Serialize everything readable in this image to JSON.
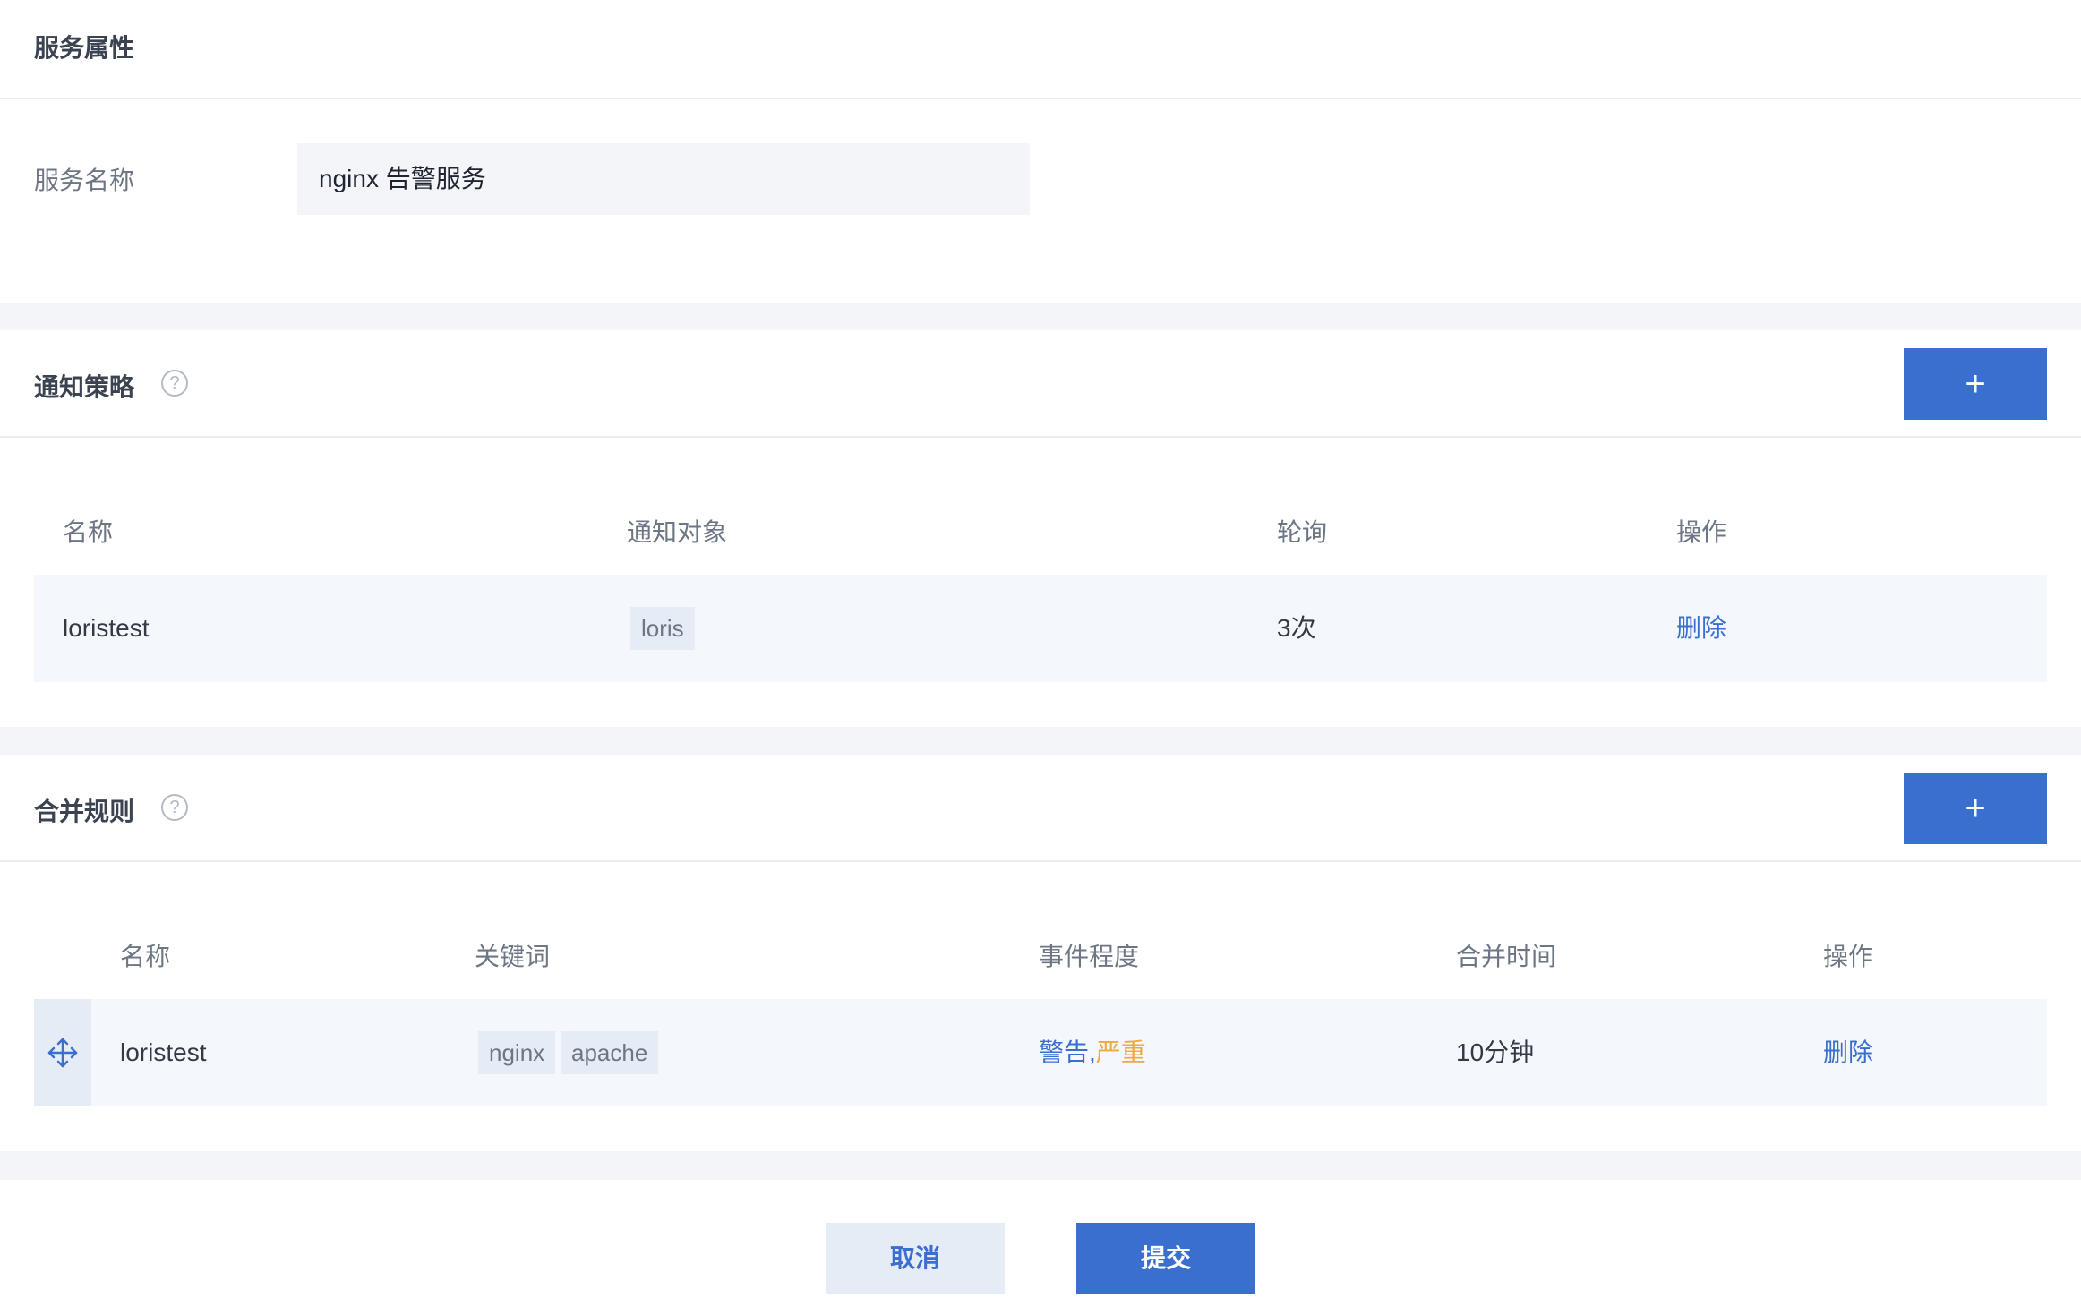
{
  "service": {
    "title": "服务属性",
    "name_label": "服务名称",
    "name_value": "nginx 告警服务"
  },
  "notify": {
    "title": "通知策略",
    "help": "?",
    "add": "+",
    "headers": [
      "名称",
      "通知对象",
      "轮询",
      "操作"
    ],
    "row": {
      "name": "loristest",
      "target_tag": "loris",
      "polling": "3次",
      "action": "删除"
    }
  },
  "merge": {
    "title": "合并规则",
    "help": "?",
    "add": "+",
    "headers": [
      "名称",
      "关键词",
      "事件程度",
      "合并时间",
      "操作"
    ],
    "row": {
      "name": "loristest",
      "keywords": [
        "nginx",
        "apache"
      ],
      "severity_warn": "警告",
      "separator": ",",
      "severity_crit": "严重",
      "merge_time": "10分钟",
      "action": "删除"
    }
  },
  "footer": {
    "cancel": "取消",
    "submit": "提交"
  },
  "colors": {
    "primary": "#3a6fd0",
    "warning": "#f2a93b",
    "background": "#f3f5f8"
  }
}
